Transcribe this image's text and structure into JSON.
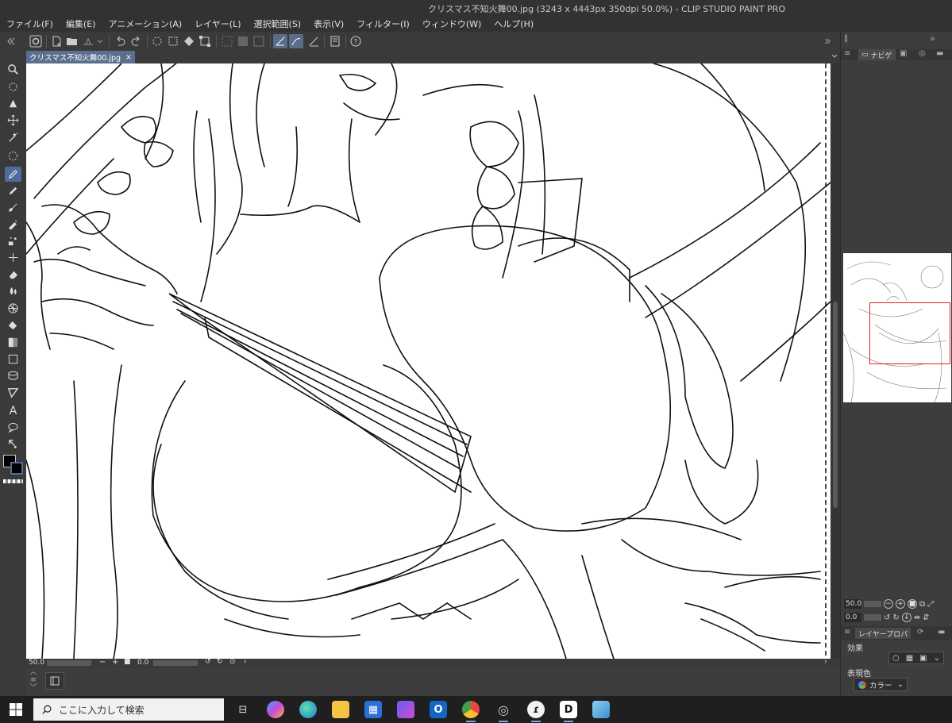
{
  "window": {
    "title": "クリスマス不知火舞00.jpg (3243 x 4443px 350dpi 50.0%) - CLIP STUDIO PAINT PRO"
  },
  "menu": [
    {
      "label": "ファイル(F)"
    },
    {
      "label": "編集(E)"
    },
    {
      "label": "アニメーション(A)"
    },
    {
      "label": "レイヤー(L)"
    },
    {
      "label": "選択範囲(S)"
    },
    {
      "label": "表示(V)"
    },
    {
      "label": "フィルター(I)"
    },
    {
      "label": "ウィンドウ(W)"
    },
    {
      "label": "ヘルプ(H)"
    }
  ],
  "document_tab": {
    "name": "クリスマス不知火舞00.jpg",
    "close": "×"
  },
  "canvas_status": {
    "zoom": "50.0",
    "rotation": "0.0"
  },
  "navigator": {
    "tab_label": "ナビゲ",
    "zoom": "50.0",
    "rotation": "0.0"
  },
  "layer_property": {
    "tab_label": "レイヤープロパ",
    "effect_label": "効果",
    "expression_color_label": "表現色",
    "expression_color_value": "カラー"
  },
  "colors": {
    "main_color": "#000000",
    "sub_color": "#000000",
    "accent": "#4f6d9b",
    "view_rect": "#e02020"
  },
  "taskbar": {
    "search_placeholder": "ここに入力して検索",
    "apps": [
      {
        "icon": "task-view-icon"
      },
      {
        "icon": "copilot-icon"
      },
      {
        "icon": "edge-icon"
      },
      {
        "icon": "file-explorer-icon"
      },
      {
        "icon": "store-icon"
      },
      {
        "icon": "copilot-app-icon"
      },
      {
        "icon": "outlook-icon"
      },
      {
        "icon": "chrome-icon"
      },
      {
        "icon": "clip-studio-icon"
      },
      {
        "icon": "clip-studio-paint-icon"
      },
      {
        "icon": "app-d-icon"
      },
      {
        "icon": "app-blue-icon"
      }
    ]
  }
}
